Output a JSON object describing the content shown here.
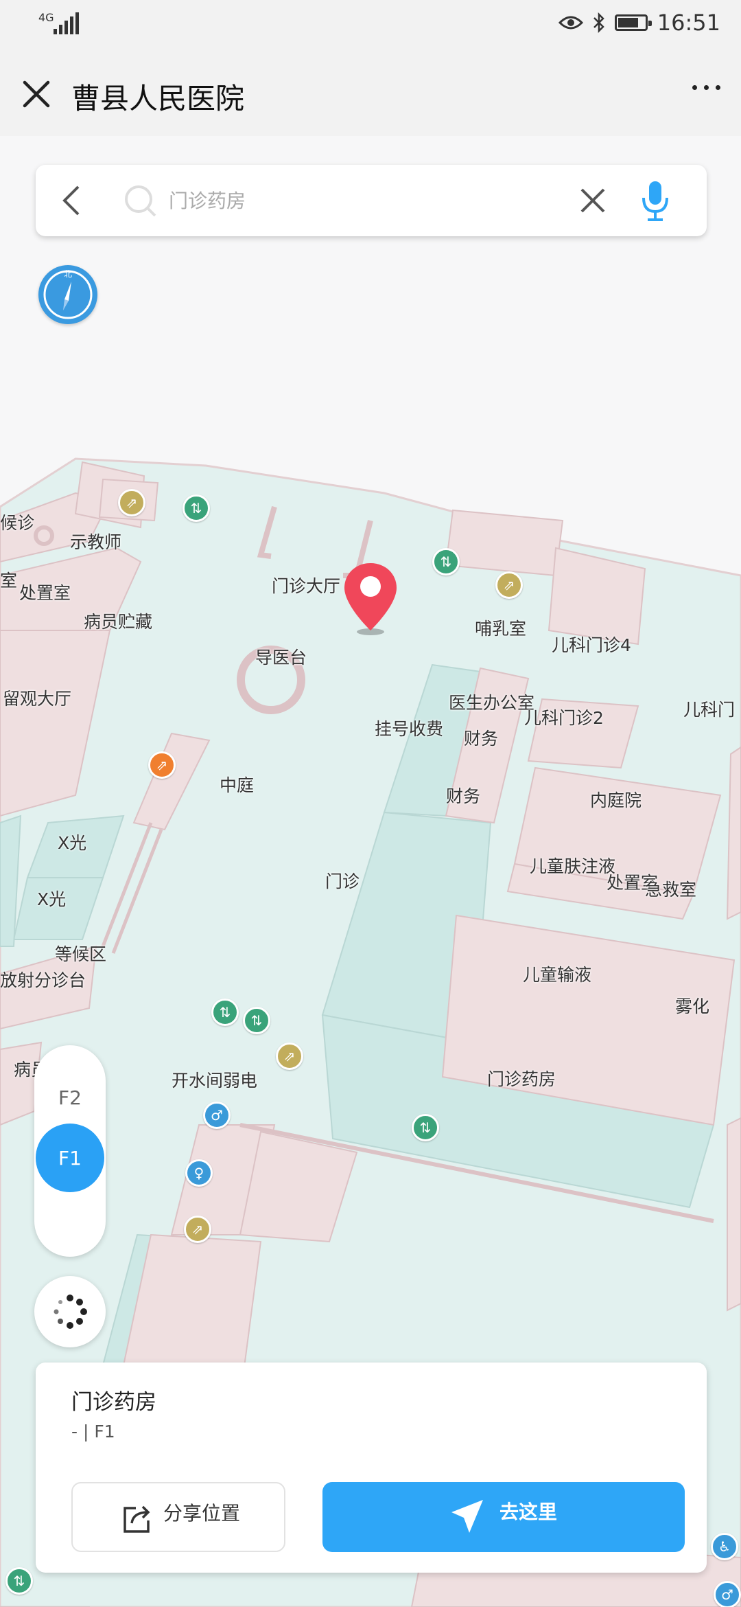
{
  "status_bar": {
    "network": "4G",
    "time": "16:51",
    "battery_level": 0.75
  },
  "header": {
    "title": "曹县人民医院"
  },
  "search": {
    "placeholder": "门诊药房",
    "value": ""
  },
  "compass": {
    "label": "北"
  },
  "map_labels": {
    "houzhen": "候诊",
    "shijiaoshi": "示教师",
    "shi": "室",
    "chuzhishi": "处置室",
    "bingyuanzhucang": "病员贮藏",
    "liuguandating": "留观大厅",
    "menzhendating": "门诊大厅",
    "daoyitai": "导医台",
    "buru": "哺乳室",
    "erkemenzhen4": "儿科门诊4",
    "yishengbangongshi": "医生办公室",
    "guahaoshoufei": "挂号收费",
    "caiwu1": "财务",
    "erkemenzhen2": "儿科门诊2",
    "erkemen_edge": "儿科门",
    "zhongting": "中庭",
    "caiwu2": "财务",
    "neitingyuan": "内庭院",
    "xguang1": "X光",
    "erfuzhuye": "儿童肤注液",
    "chuzhishi2": "处置室",
    "jijiushi": "急救室",
    "menzhen_partial": "门诊",
    "xguang2": "X光",
    "denghouqu": "等候区",
    "fangshefenzhen": "放射分诊台",
    "ertongshuye": "儿童输液",
    "wuhua": "雾化",
    "bingyuan_edge": "病员",
    "kaishuijianrd": "开水间弱电",
    "menzhenyaofang": "门诊药房"
  },
  "floors": {
    "upper": "F2",
    "current": "F1"
  },
  "place_card": {
    "name": "门诊药房",
    "detail": "- | F1",
    "share_label": "分享位置",
    "go_label": "去这里"
  },
  "colors": {
    "room_pink": "#efdfe0",
    "room_teal": "#cde8e5",
    "corridor": "#e2f1ef",
    "primary_blue": "#2ea6f7",
    "marker_red": "#f0475a"
  }
}
